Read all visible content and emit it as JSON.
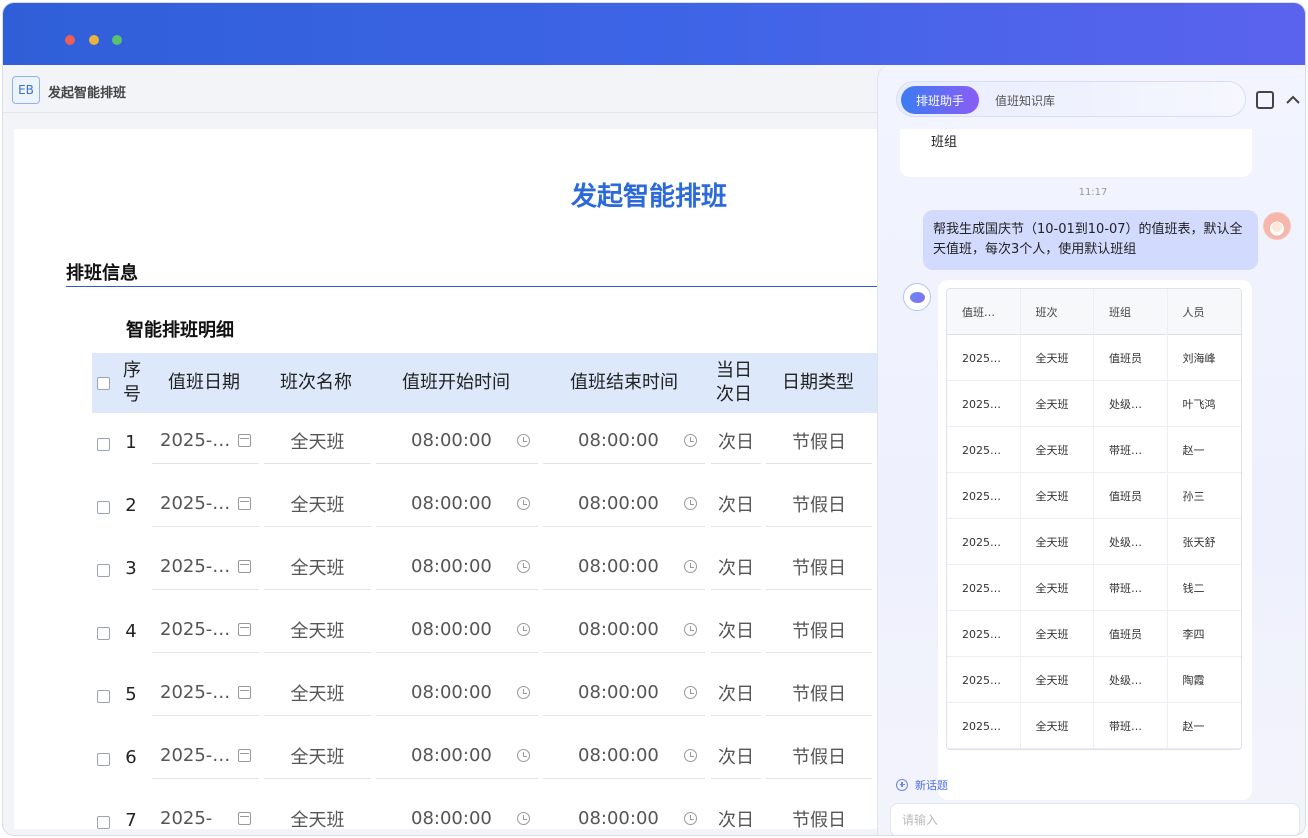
{
  "app": {
    "logo": "EB",
    "title": "发起智能排班"
  },
  "form": {
    "title": "发起智能排班",
    "section": "排班信息",
    "subsection": "智能排班明细"
  },
  "table": {
    "columns": [
      "序号",
      "值班日期",
      "班次名称",
      "值班开始时间",
      "值班结束时间",
      "当日次日",
      "日期类型"
    ],
    "rows": [
      {
        "no": "1",
        "date": "2025-…",
        "shift": "全天班",
        "start": "08:00:00",
        "end": "08:00:00",
        "day": "次日",
        "type": "节假日"
      },
      {
        "no": "2",
        "date": "2025-…",
        "shift": "全天班",
        "start": "08:00:00",
        "end": "08:00:00",
        "day": "次日",
        "type": "节假日"
      },
      {
        "no": "3",
        "date": "2025-…",
        "shift": "全天班",
        "start": "08:00:00",
        "end": "08:00:00",
        "day": "次日",
        "type": "节假日"
      },
      {
        "no": "4",
        "date": "2025-…",
        "shift": "全天班",
        "start": "08:00:00",
        "end": "08:00:00",
        "day": "次日",
        "type": "节假日"
      },
      {
        "no": "5",
        "date": "2025-…",
        "shift": "全天班",
        "start": "08:00:00",
        "end": "08:00:00",
        "day": "次日",
        "type": "节假日"
      },
      {
        "no": "6",
        "date": "2025-…",
        "shift": "全天班",
        "start": "08:00:00",
        "end": "08:00:00",
        "day": "次日",
        "type": "节假日"
      },
      {
        "no": "7",
        "date": "2025-",
        "shift": "全天班",
        "start": "08:00:00",
        "end": "08:00:00",
        "day": "次日",
        "type": "节假日"
      }
    ]
  },
  "panel": {
    "tabs": [
      "排班助手",
      "值班知识库"
    ],
    "prev_message_tail": "班组",
    "timestamp": "11:17",
    "user_message": "帮我生成国庆节（10-01到10-07）的值班表，默认全天值班，每次3个人，使用默认班组",
    "result_table": {
      "columns": [
        "值班…",
        "班次",
        "班组",
        "人员"
      ],
      "rows": [
        [
          "2025…",
          "全天班",
          "值班员",
          "刘海峰"
        ],
        [
          "2025…",
          "全天班",
          "处级…",
          "叶飞鸿"
        ],
        [
          "2025…",
          "全天班",
          "带班…",
          "赵一"
        ],
        [
          "2025…",
          "全天班",
          "值班员",
          "孙三"
        ],
        [
          "2025…",
          "全天班",
          "处级…",
          "张天舒"
        ],
        [
          "2025…",
          "全天班",
          "带班…",
          "钱二"
        ],
        [
          "2025…",
          "全天班",
          "值班员",
          "李四"
        ],
        [
          "2025…",
          "全天班",
          "处级…",
          "陶霞"
        ],
        [
          "2025…",
          "全天班",
          "带班…",
          "赵一"
        ]
      ]
    },
    "new_topic": "新话题",
    "input_placeholder": "请输入"
  }
}
